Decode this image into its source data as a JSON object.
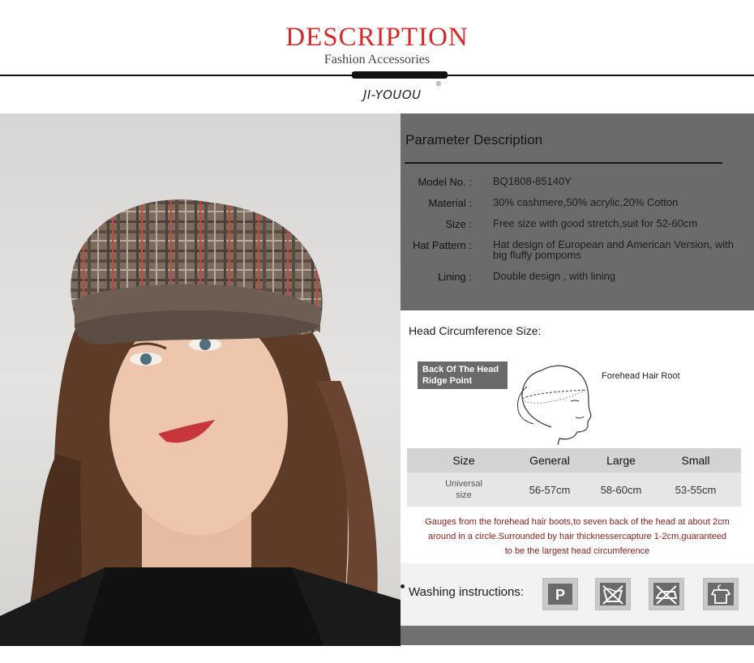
{
  "header": {
    "title": "DESCRIPTION",
    "subtitle": "Fashion Accessories",
    "brand": "JI-YOUOU",
    "brand_mark": "®"
  },
  "parameters": {
    "title": "Parameter Description",
    "rows": [
      {
        "label": "Model No. :",
        "value": "BQ1808-85140Y"
      },
      {
        "label": "Material :",
        "value": "30% cashmere,50% acrylic,20% Cotton"
      },
      {
        "label": "Size :",
        "value": "Free size with good stretch,suit for 52-60cm"
      },
      {
        "label": "Hat Pattern :",
        "value": "Hat design of European and American Version, with big fluffy pompoms"
      },
      {
        "label": "Lining :",
        "value": "Double design , with lining"
      }
    ]
  },
  "head_circumference": {
    "title": "Head Circumference Size:",
    "back_label": "Back Of The Head Ridge Point",
    "forehead_label": "Forehead Hair Root"
  },
  "size_table": {
    "headers": [
      "Size",
      "General",
      "Large",
      "Small"
    ],
    "row": [
      "Universal size",
      "56-57cm",
      "58-60cm",
      "53-55cm"
    ]
  },
  "gauge_note": {
    "lines": [
      "Gauges from the forehead hair boots,to seven back of the head at about 2cm",
      "around in a circle.Surrounded by hair thicknessercapture 1-2cm,guaranteed",
      "to be the largest head circumference"
    ]
  },
  "washing": {
    "label": "Washing instructions:",
    "icons": [
      "dry-clean-p-icon",
      "no-wash-icon",
      "no-iron-icon",
      "hang-dry-icon"
    ],
    "icon_texts": [
      "P"
    ]
  },
  "colors": {
    "title_red": "#d42a2a",
    "panel_gray": "#6b6b6b",
    "note_red": "#8b1a1a"
  },
  "photo": {
    "subject": "model-wearing-plaid-beret-icon"
  }
}
